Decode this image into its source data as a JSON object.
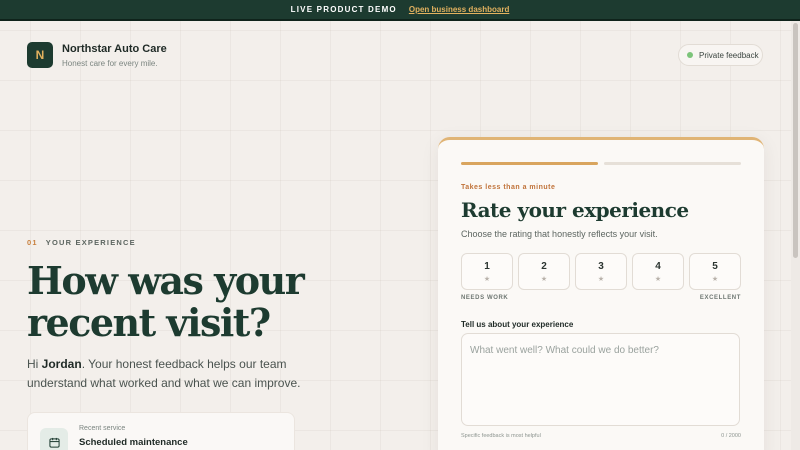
{
  "banner": {
    "demo_label": "LIVE PRODUCT DEMO",
    "link_label": "Open business dashboard"
  },
  "brand": {
    "logo_letter": "N",
    "name": "Northstar Auto Care",
    "tagline": "Honest care for every mile."
  },
  "privacy": {
    "label": "Private feedback",
    "dot_color": "#7cc47a"
  },
  "hero": {
    "step_number": "01",
    "step_label": "YOUR EXPERIENCE",
    "title": "How was your recent visit?",
    "greeting": "Hi ",
    "customer_name": "Jordan",
    "subtitle_rest": ". Your honest feedback helps our team understand what worked and what we can improve."
  },
  "service": {
    "label": "Recent service",
    "value": "Scheduled maintenance",
    "icon": "calendar-icon"
  },
  "form": {
    "kicker": "Takes less than a minute",
    "title": "Rate your experience",
    "subtitle": "Choose the rating that honestly reflects your visit.",
    "progress": {
      "completed_steps": 1,
      "total_steps": 2
    },
    "ratings": [
      {
        "value": "1",
        "icon": "star-icon"
      },
      {
        "value": "2",
        "icon": "star-icon"
      },
      {
        "value": "3",
        "icon": "star-icon"
      },
      {
        "value": "4",
        "icon": "star-icon"
      },
      {
        "value": "5",
        "icon": "star-icon"
      }
    ],
    "scale_low": "NEEDS WORK",
    "scale_high": "EXCELLENT",
    "feedback_label": "Tell us about your experience",
    "feedback_placeholder": "What went well? What could we do better?",
    "feedback_value": "",
    "hint": "Specific feedback is most helpful",
    "char_count": "0 / 2000"
  },
  "colors": {
    "primary": "#1d3b30",
    "accent": "#e3b25f",
    "kicker": "#c0733a",
    "background": "#f3efeb"
  }
}
